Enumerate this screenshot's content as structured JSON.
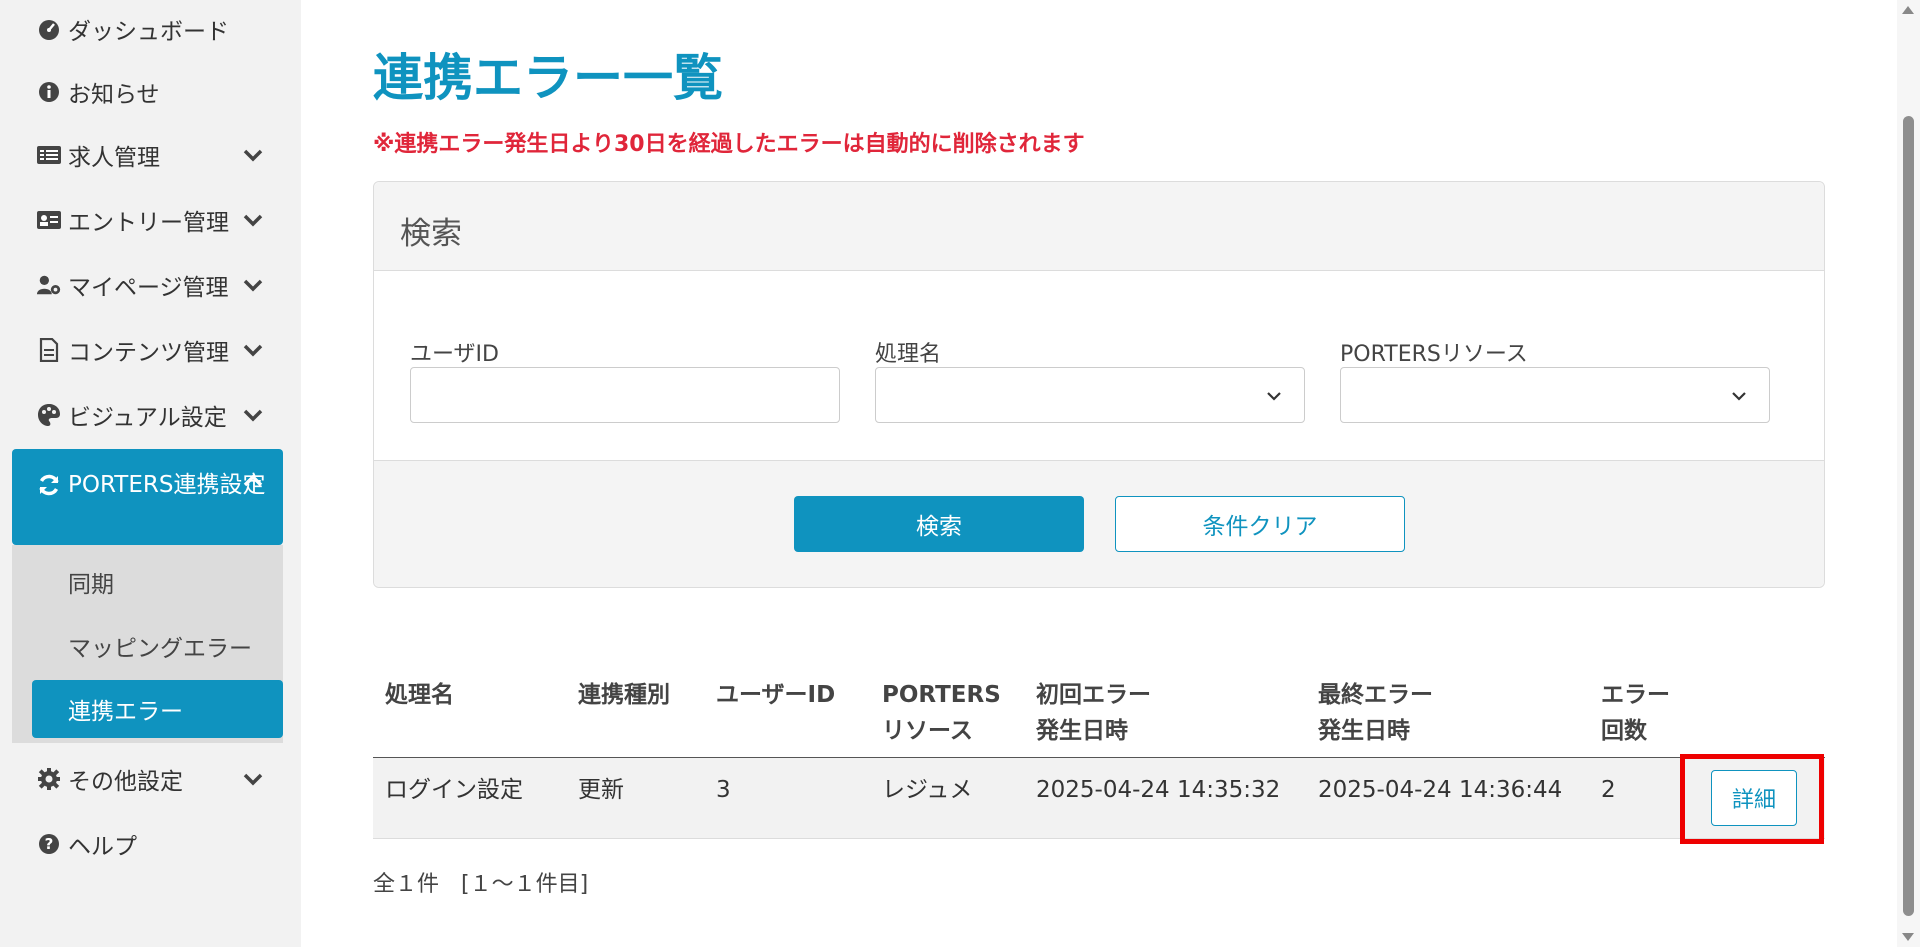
{
  "sidebar": {
    "items": [
      {
        "label": "ダッシュボード",
        "icon": "gauge-icon"
      },
      {
        "label": "お知らせ",
        "icon": "info-icon"
      },
      {
        "label": "求人管理",
        "icon": "list-icon"
      },
      {
        "label": "エントリー管理",
        "icon": "id-card-icon"
      },
      {
        "label": "マイページ管理",
        "icon": "user-gear-icon"
      },
      {
        "label": "コンテンツ管理",
        "icon": "document-icon"
      },
      {
        "label": "ビジュアル設定",
        "icon": "palette-icon"
      },
      {
        "label": "PORTERS連携設定",
        "icon": "sync-icon"
      },
      {
        "label": "その他設定",
        "icon": "gear-icon"
      },
      {
        "label": "ヘルプ",
        "icon": "question-icon"
      }
    ],
    "submenu": [
      "同期",
      "マッピングエラー",
      "連携エラー"
    ]
  },
  "page": {
    "title": "連携エラー一覧",
    "notice": "※連携エラー発生日より30日を経過したエラーは自動的に削除されます"
  },
  "search": {
    "header": "検索",
    "user_id_label": "ユーザID",
    "process_label": "処理名",
    "resource_label": "PORTERSリソース",
    "user_id_value": "",
    "search_button": "検索",
    "clear_button": "条件クリア"
  },
  "table": {
    "headers": {
      "process": "処理名",
      "type": "連携種別",
      "user_id": "ユーザーID",
      "resource_1": "PORTERS",
      "resource_2": "リソース",
      "first_1": "初回エラー",
      "first_2": "発生日時",
      "last_1": "最終エラー",
      "last_2": "発生日時",
      "count_1": "エラー",
      "count_2": "回数"
    },
    "rows": [
      {
        "process": "ログイン設定",
        "type": "更新",
        "user_id": "3",
        "resource": "レジュメ",
        "first": "2025-04-24 14:35:32",
        "last": "2025-04-24 14:36:44",
        "count": "2",
        "detail": "詳細"
      }
    ],
    "summary": "全１件　[１〜１件目]"
  },
  "colors": {
    "accent": "#0f93bf",
    "notice": "#e0263a",
    "highlight": "#ee0000"
  }
}
